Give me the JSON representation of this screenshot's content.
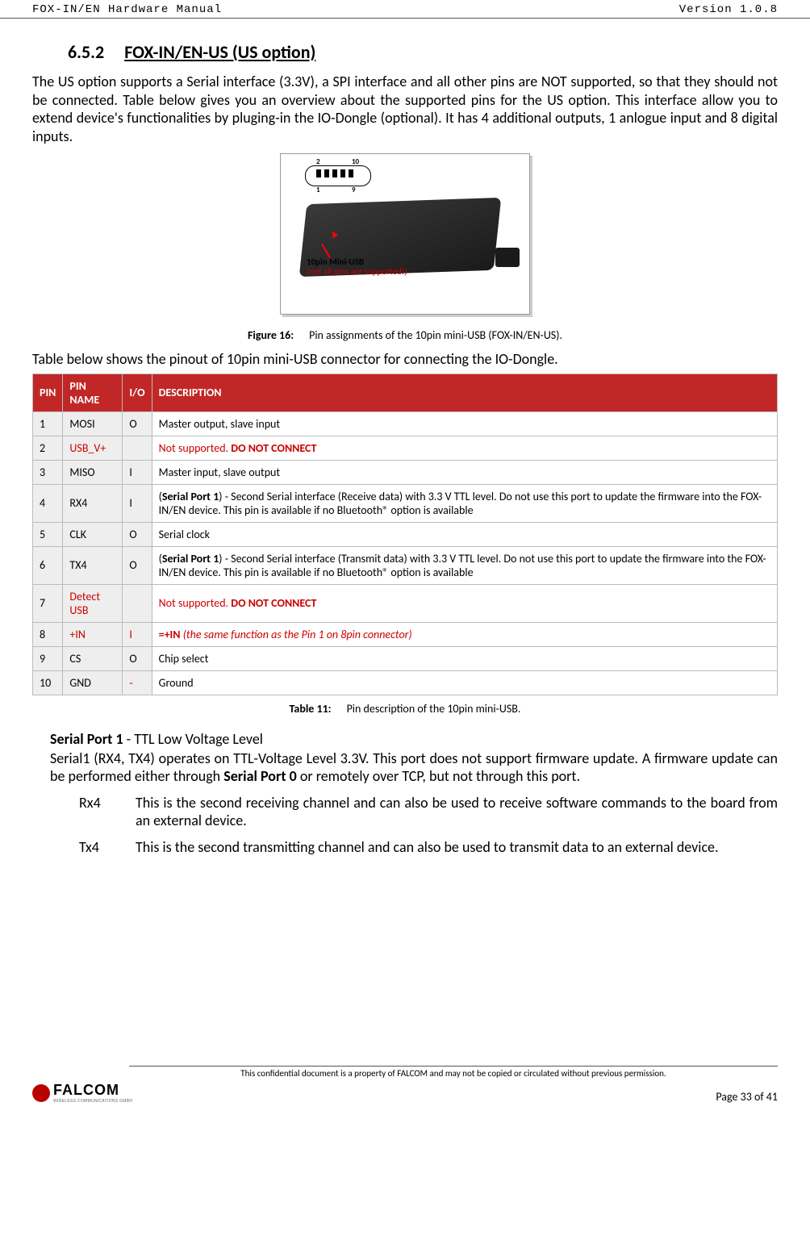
{
  "header": {
    "left": "FOX-IN/EN Hardware Manual",
    "right": "Version 1.0.8"
  },
  "section": {
    "number": "6.5.2",
    "title": "FOX-IN/EN-US (US option)"
  },
  "intro": "The US option supports a Serial interface (3.3V), a SPI interface and all other pins are NOT supported, so that they should not be connected. Table below gives you an overview about the supported pins for the US option. This interface allow you to extend device's functionalities by pluging-in the IO-Dongle (optional). It has 4 additional outputs, 1 anlogue input and 8 digital inputs.",
  "figure": {
    "conn_labels": {
      "tl": "2",
      "tr": "10",
      "bl": "1",
      "br": "9"
    },
    "usb_label_line1": "10pin Mini-USB",
    "usb_label_line2": "(not all pins are supported!)",
    "caption_label": "Figure 16:",
    "caption_text": "Pin assignments of the 10pin mini-USB (FOX-IN/EN-US)."
  },
  "table_intro": "Table below shows the pinout of 10pin mini-USB connector for connecting the IO-Dongle.",
  "table": {
    "headers": [
      "PIN",
      "PIN NAME",
      "I/O",
      "DESCRIPTION"
    ],
    "rows": [
      {
        "pin": "1",
        "name": "MOSI",
        "io": "O",
        "desc": "Master output, slave input",
        "red": false
      },
      {
        "pin": "2",
        "name": "USB_V+",
        "io": "",
        "desc": "Not supported. ",
        "desc_bold": "DO NOT CONNECT",
        "red": true
      },
      {
        "pin": "3",
        "name": "MISO",
        "io": "I",
        "desc": "Master input, slave output",
        "red": false
      },
      {
        "pin": "4",
        "name": "RX4",
        "io": "I",
        "desc_prefix": "(",
        "desc_bold_black": "Serial Port 1",
        "desc_rest": ") - Second Serial interface (Receive data) with 3.3 V TTL level. Do not use this port to update the firmware into the FOX-IN/EN device. This pin is available if no Bluetooth® option is available",
        "red": false,
        "complex": true
      },
      {
        "pin": "5",
        "name": "CLK",
        "io": "O",
        "desc": "Serial clock",
        "red": false
      },
      {
        "pin": "6",
        "name": "TX4",
        "io": "O",
        "desc_prefix": "(",
        "desc_bold_black": "Serial Port 1",
        "desc_rest": ") - Second Serial interface (Transmit data) with 3.3 V TTL level. Do not use this port to update the firmware into the FOX-IN/EN device. This pin is available if no Bluetooth® option is available",
        "red": false,
        "complex": true
      },
      {
        "pin": "7",
        "name": "Detect USB",
        "io": "",
        "desc": "Not supported. ",
        "desc_bold": "DO NOT CONNECT",
        "red": true
      },
      {
        "pin": "8",
        "name": "+IN",
        "io": "I",
        "desc_bold": "=+IN ",
        "desc_italic": "(the same function as the Pin 1 on 8pin connector)",
        "red": true,
        "in_row": true
      },
      {
        "pin": "9",
        "name": "CS",
        "io": "O",
        "desc": "Chip select",
        "red": false
      },
      {
        "pin": "10",
        "name": "GND",
        "io": "-",
        "io_red": true,
        "desc": "Ground",
        "red": false
      }
    ],
    "caption_label": "Table 11:",
    "caption_text": "Pin description of the 10pin mini-USB."
  },
  "serial_port": {
    "title_bold": "Serial Port 1",
    "title_rest": " - TTL Low Voltage Level",
    "body_pre": "Serial1 (RX4, TX4) operates on TTL-Voltage Level 3.3V. This port does not support firmware update. A firmware update can be performed either through ",
    "body_bold": "Serial Port 0",
    "body_post": " or remotely over TCP, but not through this port.",
    "defs": [
      {
        "term": "Rx4",
        "desc": "This is the second receiving channel and can also be used to receive software commands to the board from an external device."
      },
      {
        "term": "Tx4",
        "desc": "This is the second transmitting channel and can also be used to transmit data to an external device."
      }
    ]
  },
  "footer": {
    "disclaimer": "This confidential document is a property of FALCOM and may not be copied or circulated without previous permission.",
    "logo_text": "FALCOM",
    "logo_sub": "WIRELESS COMMUNICATIONS GMBH",
    "page": "Page 33 of 41"
  }
}
